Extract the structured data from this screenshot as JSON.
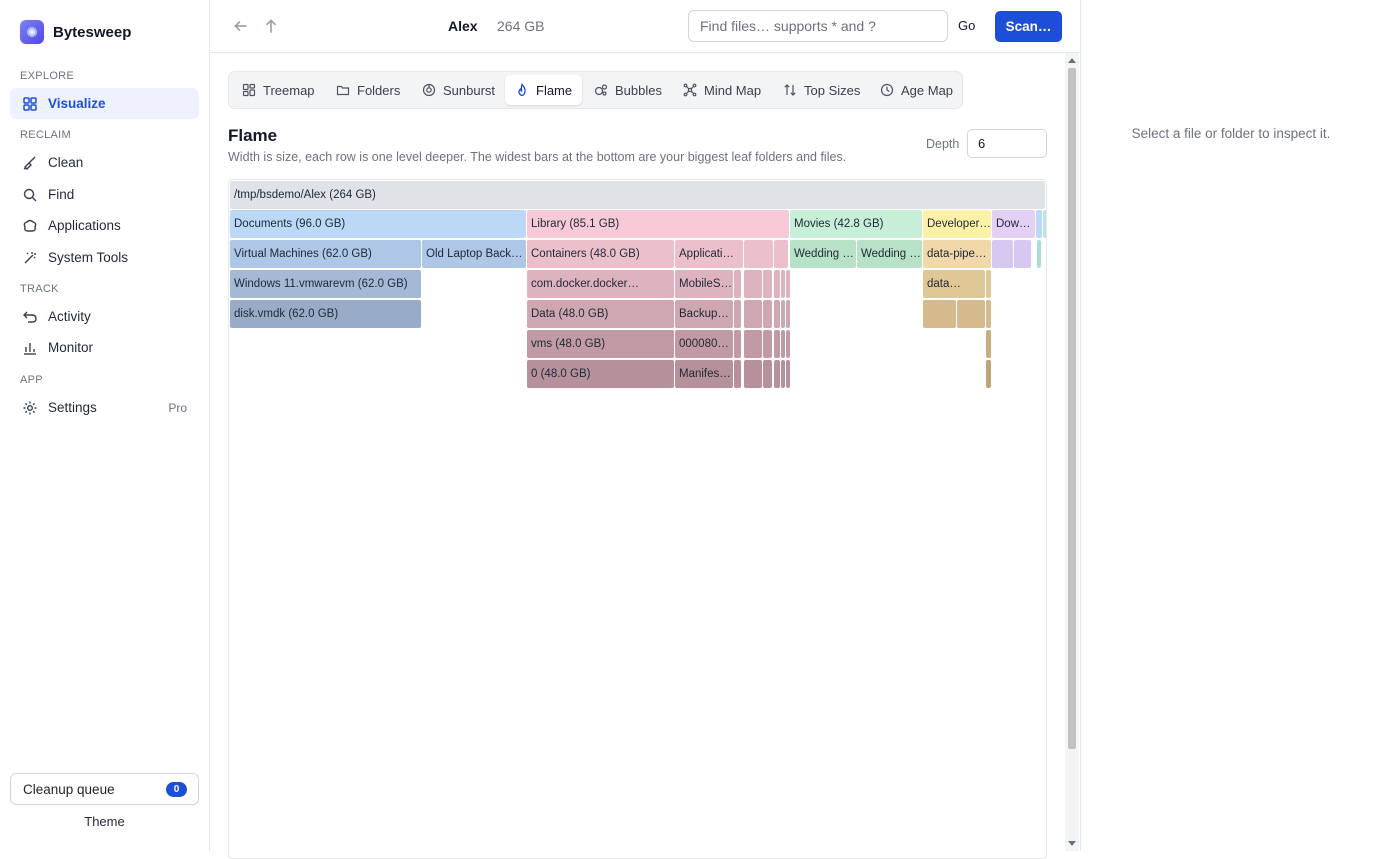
{
  "app": {
    "name": "Bytesweep"
  },
  "sidebar": {
    "sections": [
      {
        "label": "EXPLORE",
        "items": [
          {
            "label": "Visualize",
            "icon": "grid-icon",
            "active": true
          }
        ]
      },
      {
        "label": "RECLAIM",
        "items": [
          {
            "label": "Clean",
            "icon": "broom-icon"
          },
          {
            "label": "Find",
            "icon": "search-icon"
          },
          {
            "label": "Applications",
            "icon": "app-icon"
          },
          {
            "label": "System Tools",
            "icon": "wand-icon"
          }
        ]
      },
      {
        "label": "TRACK",
        "items": [
          {
            "label": "Activity",
            "icon": "undo-icon"
          },
          {
            "label": "Monitor",
            "icon": "bar-chart-icon"
          }
        ]
      },
      {
        "label": "APP",
        "items": [
          {
            "label": "Settings",
            "icon": "gear-icon",
            "badge": "Pro"
          }
        ]
      }
    ],
    "cleanup_queue": {
      "label": "Cleanup queue",
      "count": "0"
    },
    "theme_label": "Theme"
  },
  "topbar": {
    "location_name": "Alex",
    "location_size": "264 GB",
    "search_placeholder": "Find files… supports * and ?",
    "go_label": "Go",
    "scan_label": "Scan…"
  },
  "tabs": [
    {
      "label": "Treemap",
      "icon": "treemap-icon"
    },
    {
      "label": "Folders",
      "icon": "folder-icon"
    },
    {
      "label": "Sunburst",
      "icon": "sunburst-icon"
    },
    {
      "label": "Flame",
      "icon": "flame-icon",
      "active": true
    },
    {
      "label": "Bubbles",
      "icon": "bubbles-icon"
    },
    {
      "label": "Mind Map",
      "icon": "mindmap-icon"
    },
    {
      "label": "Top Sizes",
      "icon": "sort-icon"
    },
    {
      "label": "Age Map",
      "icon": "clock-icon"
    }
  ],
  "view": {
    "title": "Flame",
    "subtitle": "Width is size, each row is one level deeper. The widest bars at the bottom are your biggest leaf folders and files.",
    "depth_label": "Depth",
    "depth_value": "6"
  },
  "flame": {
    "root": "/tmp/bsdemo/Alex (264 GB)",
    "rows": [
      [
        "Documents (96.0 GB)",
        "Library (85.1 GB)",
        "Movies (42.8 GB)",
        "Developer…",
        "Downl…"
      ],
      [
        "Virtual Machines (62.0 GB)",
        "Old Laptop Back…",
        "Containers (48.0 GB)",
        "Applicati…",
        "Wedding 4…",
        "Wedding 4…",
        "data-pipe…"
      ],
      [
        "Windows 11.vmwarevm (62.0 GB)",
        "com.docker.docker…",
        "MobileS…",
        "data…"
      ],
      [
        "disk.vmdk (62.0 GB)",
        "Data (48.0 GB)",
        "Backup…"
      ],
      [
        "vms (48.0 GB)",
        "0000803…"
      ],
      [
        "0 (48.0 GB)",
        "Manifes…"
      ]
    ],
    "colors": {
      "root": "#dfe3e8",
      "documents": "#bcd8f7",
      "library": "#f8c9d6",
      "movies": "#c7eed7",
      "developer": "#fdf1a8",
      "downloads": "#e2d0f5",
      "teal": "#b8e6e0"
    }
  },
  "inspector": {
    "hint": "Select a file or folder to inspect it."
  }
}
